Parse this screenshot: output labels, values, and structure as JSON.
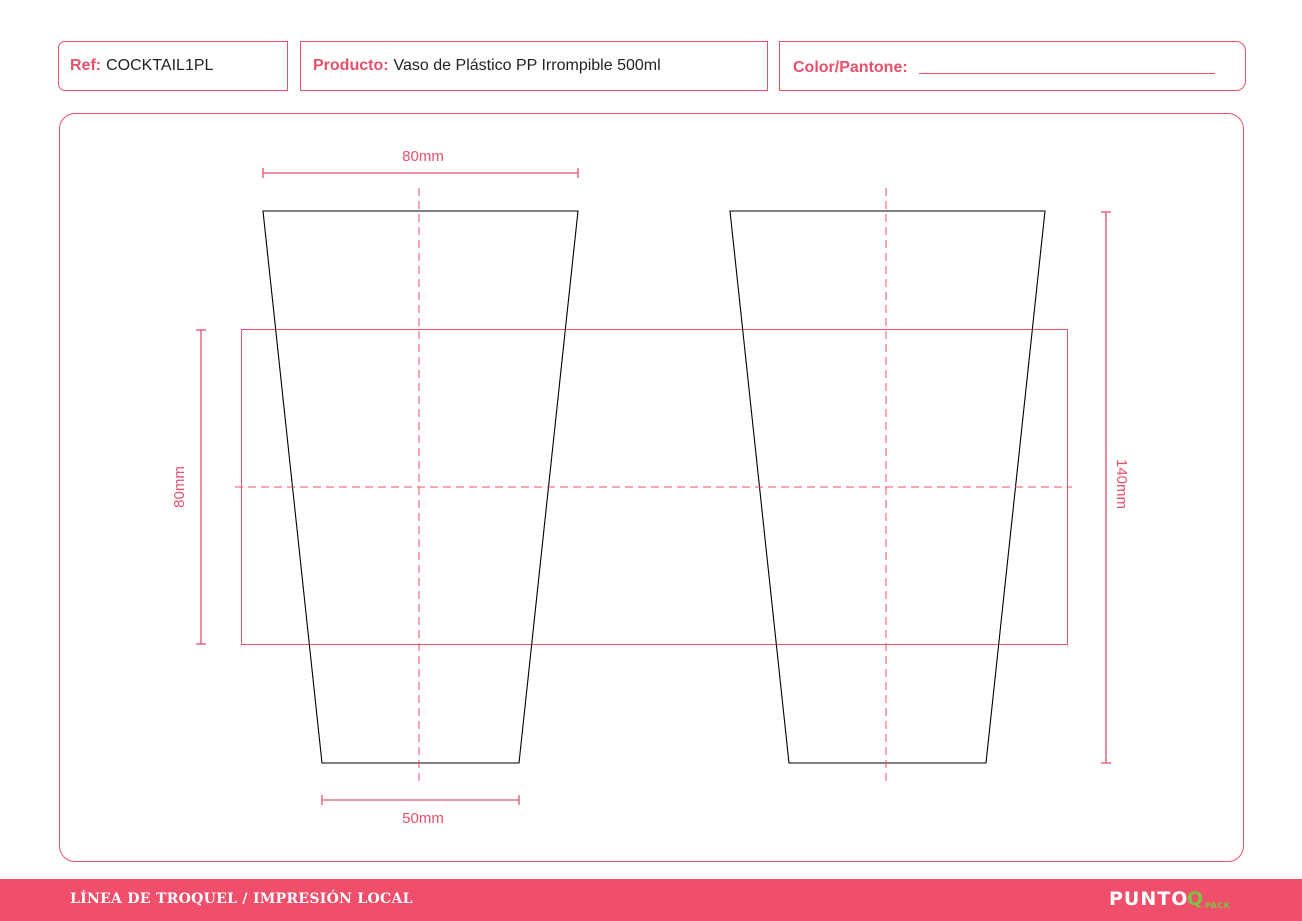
{
  "header": {
    "ref_label": "Ref:",
    "ref_value": "COCKTAIL1PL",
    "product_label": "Producto:",
    "product_value": "Vaso de Plástico PP Irrompible 500ml",
    "color_label": "Color/Pantone:"
  },
  "diagram": {
    "dim_top_width": "80mm",
    "dim_bottom_width": "50mm",
    "dim_print_height": "80mm",
    "dim_total_height": "140mm",
    "accent_color": "#e8506b",
    "outline_color": "#000000"
  },
  "footer": {
    "title": "LÍNEA DE TROQUEL / IMPRESIÓN LOCAL",
    "logo_main": "PUNTO",
    "logo_q": "Q",
    "logo_sub": "PACK",
    "background_color": "#f04f6b"
  }
}
